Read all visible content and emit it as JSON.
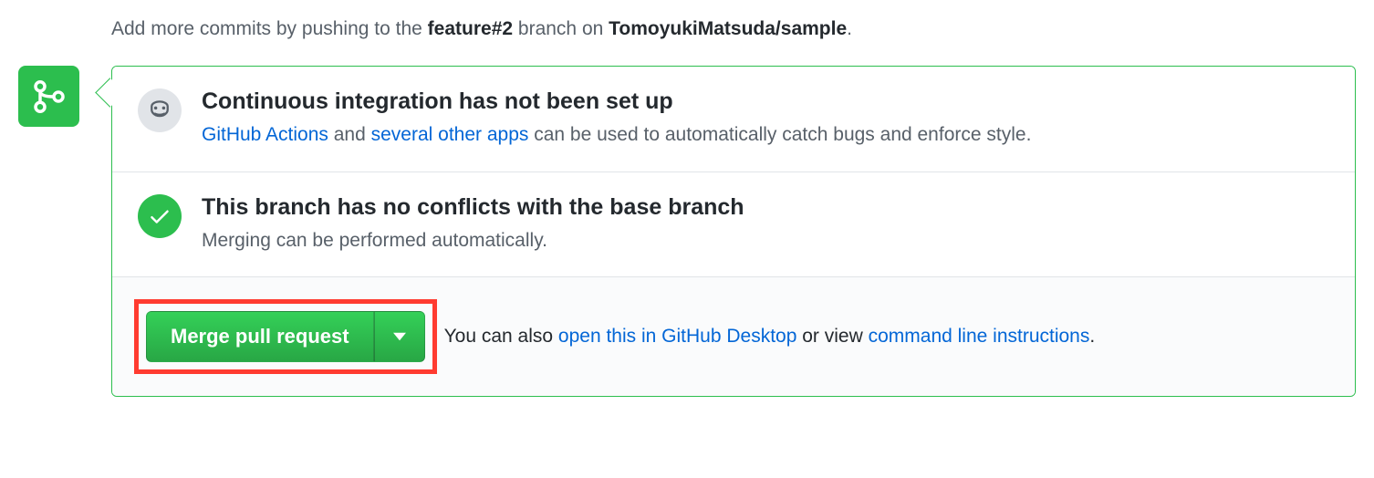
{
  "hint": {
    "prefix": "Add more commits by pushing to the ",
    "branch": "feature#2",
    "mid": " branch on ",
    "repo": "TomoyukiMatsuda/sample",
    "suffix": "."
  },
  "ci": {
    "title": "Continuous integration has not been set up",
    "link1": "GitHub Actions",
    "mid1": " and ",
    "link2": "several other apps",
    "rest": " can be used to automatically catch bugs and enforce style."
  },
  "conflict": {
    "title": "This branch has no conflicts with the base branch",
    "sub": "Merging can be performed automatically."
  },
  "footer": {
    "merge_label": "Merge pull request",
    "also_prefix": "You can also ",
    "link_desktop": "open this in GitHub Desktop",
    "or_view": " or view ",
    "link_cli": "command line instructions",
    "period": "."
  }
}
